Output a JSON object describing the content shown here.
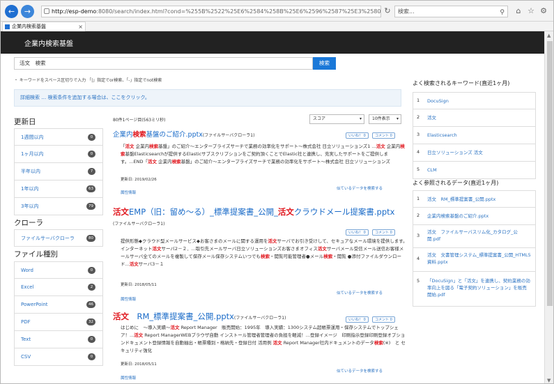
{
  "browser": {
    "url_domain": "http://esp-demo",
    "url_rest": ":8080/search/index.html?cond=%255B%2522%25E6%2584%258B%25E6%2596%2587%25E3%2580%2580%25E",
    "search_placeholder": "検索...",
    "tab_title": "企業内検索基盤",
    "back_icon": "back-arrow-icon",
    "forward_icon": "forward-arrow-icon"
  },
  "app": {
    "title": "企業内検索基盤"
  },
  "search": {
    "query": "活文　検索",
    "button_label": "検索",
    "hint": "・ キーワードをスペース区切りで入力 「|」指定でor検索、「-」指定でnot検索",
    "advanced": "詳細検索 … 検索条件を追加する場合は、ここをクリック。"
  },
  "facets": {
    "updated_heading": "更新日",
    "updated": [
      {
        "label": "1週間以内",
        "count": "0"
      },
      {
        "label": "1ヶ月以内",
        "count": "0"
      },
      {
        "label": "半年以内",
        "count": "7"
      },
      {
        "label": "1年以内",
        "count": "63"
      },
      {
        "label": "3年以内",
        "count": "79"
      }
    ],
    "crawler_heading": "クローラ",
    "crawler": [
      {
        "label": "ファイルサーバクローラ",
        "count": "80"
      }
    ],
    "filetype_heading": "ファイル種別",
    "filetype": [
      {
        "label": "Word",
        "count": "0"
      },
      {
        "label": "Excel",
        "count": "2"
      },
      {
        "label": "PowerPoint",
        "count": "46"
      },
      {
        "label": "PDF",
        "count": "32"
      },
      {
        "label": "Text",
        "count": "0"
      },
      {
        "label": "CSV",
        "count": "0"
      }
    ]
  },
  "results_meta": {
    "count_text": "80件1ページ目(563ミリ秒)",
    "sort_value": "スコア",
    "per_page_value": "10件表示"
  },
  "labels": {
    "like": "いいね！",
    "comment": "コメント",
    "attributes": "属性情報",
    "similar": "似ているデータを検索する"
  },
  "results": [
    {
      "title": "企業内検索基盤のご紹介.pptx",
      "source": "(ファイルサーバクローラ1)",
      "snippet": "「活文 企業内検索基盤」のご紹介～エンタープライズサーチで業務の効率化をサポート～株式会社 日立ソリューションズ1 ...活文 企業内検索基盤Elasticsearchが提供するElasticサブスクリプションをご契約頂くことでElastic社と連携し、充実したサポートをご提供します。...END「活文 企業内検索基盤」のご紹介～エンタープライズサーチで業務の効率化をサポート～株式会社 日立ソリューションズ",
      "date": "更新日: 2019/02/26"
    },
    {
      "title": "活文EMP（旧：留め～る）_標準提案書_公開_活文クラウドメール提案書.pptx",
      "source": "(ファイルサーバクローラ1)",
      "snippet": "提供形態◆クラウド型メールサービス◆お客さまのメールに関する運用を活文サーバでお引き受けして、セキュアなメール環境を提供します。インターネット活文サーバ2－２．...取引先メールサーバ日立ソリューションズお客さまオフィス活文サーバメール受信メール送信お客様メールサーバ全てのメールを複製して保存メール保存システムいつでも検索・閲覧可能管理者●メール検索・閲覧 ●添付ファイルダウンロード...活文サーバ3－１",
      "date": "更新日: 2018/05/11"
    },
    {
      "title": "活文　RM_標準提案書_公開.pptx",
      "source": "(ファイルサーバクローラ1)",
      "snippet": "はじめに　～導入実績～活文 Report Manager　販売開始：1995年　導入実績：1300システム超帳票運用・保存システムでトップシェア！...活文 Report ManagerWEBブラウザ自動 インストール管理者管理者の負担を軽減！...登録イメージ　印刷指示登録印刷登録オプションドキュメント登録情報を自動抽出・帳票種別・格納先・登録日付 活用例 活文 Report Manager社内ドキュメントのデータ検索(※)　と セキュリティ強化",
      "date": "更新日: 2018/05/11"
    }
  ],
  "popular_keywords": {
    "heading": "よく検索されるキーワード(直近1ヶ月)",
    "items": [
      {
        "num": "1",
        "text": "DocuSign"
      },
      {
        "num": "2",
        "text": "活文"
      },
      {
        "num": "3",
        "text": "Elasticsearch"
      },
      {
        "num": "4",
        "text": "日立ソリューションズ 活文"
      },
      {
        "num": "5",
        "text": "CLM"
      }
    ]
  },
  "popular_data": {
    "heading": "よく参照されるデータ(直近1ヶ月)",
    "items": [
      {
        "num": "1",
        "text": "活文　RM_標準提案書_公開.pptx"
      },
      {
        "num": "2",
        "text": "企業内検索基盤のご紹介.pptx"
      },
      {
        "num": "3",
        "text": "活文　ファイルサーバスリム化_カタログ_公開.pdf"
      },
      {
        "num": "4",
        "text": "活文　文書管理システム_標準提案書_公開_HTML5資料.pptx"
      },
      {
        "num": "5",
        "text": "「DocuSign」と「活文」を連携し、契約業務の効率向上を図る「電子契約ソリューション」を販売開始.pdf"
      }
    ]
  },
  "colors": {
    "accent": "#1a78d8",
    "highlight": "#e0161d",
    "header_bg": "#222222",
    "link": "#2a72c2"
  }
}
